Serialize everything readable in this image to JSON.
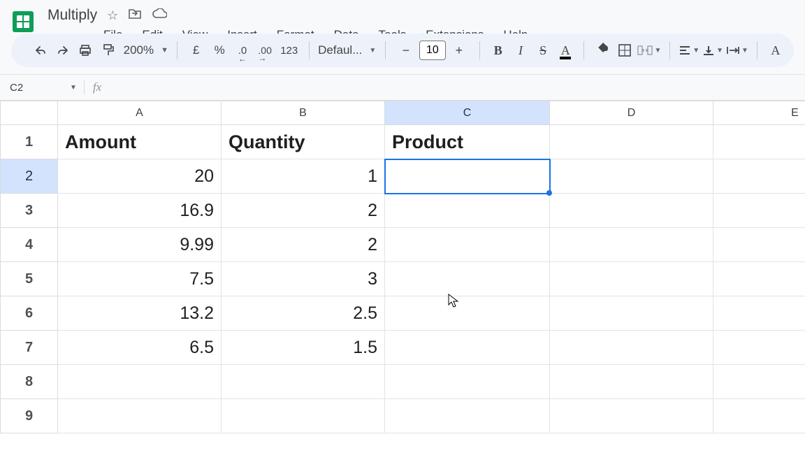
{
  "document": {
    "title": "Multiply"
  },
  "menu": {
    "file": "File",
    "edit": "Edit",
    "view": "View",
    "insert": "Insert",
    "format": "Format",
    "data": "Data",
    "tools": "Tools",
    "extensions": "Extensions",
    "help": "Help"
  },
  "toolbar": {
    "zoom": "200%",
    "currency_symbol": "£",
    "percent_symbol": "%",
    "dec_less": ".0",
    "dec_more": ".00",
    "number_format": "123",
    "font_name": "Defaul...",
    "font_size": "10",
    "bold": "B",
    "italic": "I",
    "strike": "S",
    "text_color_glyph": "A",
    "text_color_last": "A"
  },
  "namebox": {
    "ref": "C2"
  },
  "formula": {
    "value": ""
  },
  "columns": [
    "A",
    "B",
    "C",
    "D",
    "E"
  ],
  "rows_visible": 9,
  "selected": {
    "col": "C",
    "row": 2
  },
  "data": {
    "headers": {
      "A": "Amount",
      "B": "Quantity",
      "C": "Product"
    },
    "rows": [
      {
        "A": "20",
        "B": "1"
      },
      {
        "A": "16.9",
        "B": "2"
      },
      {
        "A": "9.99",
        "B": "2"
      },
      {
        "A": "7.5",
        "B": "3"
      },
      {
        "A": "13.2",
        "B": "2.5"
      },
      {
        "A": "6.5",
        "B": "1.5"
      }
    ]
  }
}
